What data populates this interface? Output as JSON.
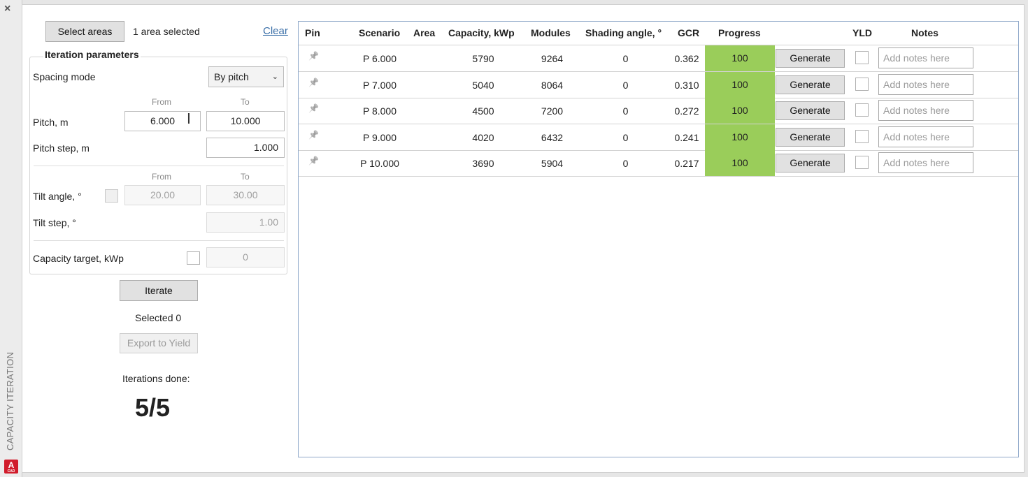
{
  "window": {
    "side_title": "CAPACITY ITERATION",
    "close_glyph": "×",
    "logo_text": "A",
    "logo_sub": "CAD"
  },
  "left": {
    "select_areas_label": "Select areas",
    "selection_status": "1 area selected",
    "clear_label": "Clear",
    "group_title": "Iteration parameters",
    "spacing_mode_label": "Spacing mode",
    "spacing_mode_value": "By pitch",
    "pitch": {
      "from_hint": "From",
      "to_hint": "To",
      "label": "Pitch, m",
      "from": "6.000",
      "to": "10.000"
    },
    "pitch_step": {
      "label": "Pitch step, m",
      "value": "1.000"
    },
    "tilt": {
      "from_hint": "From",
      "to_hint": "To",
      "label": "Tilt angle, °",
      "from": "20.00",
      "to": "30.00"
    },
    "tilt_step": {
      "label": "Tilt step, °",
      "value": "1.00"
    },
    "capacity_target": {
      "label": "Capacity target, kWp",
      "value": "0"
    },
    "iterate_label": "Iterate",
    "selected_text": "Selected 0",
    "export_label": "Export to Yield",
    "iterations_done_label": "Iterations done:",
    "iterations_done_value": "5/5"
  },
  "table": {
    "headers": {
      "pin": "Pin",
      "scenario": "Scenario",
      "area": "Area",
      "capacity": "Capacity, kWp",
      "modules": "Modules",
      "shading": "Shading angle, °",
      "gcr": "GCR",
      "progress": "Progress",
      "yld": "YLD",
      "notes": "Notes"
    },
    "generate_label": "Generate",
    "notes_placeholder": "Add notes here",
    "rows": [
      {
        "scenario": "P 6.000",
        "area": "",
        "capacity": "5790",
        "modules": "9264",
        "shading": "0",
        "gcr": "0.362",
        "progress": "100"
      },
      {
        "scenario": "P 7.000",
        "area": "",
        "capacity": "5040",
        "modules": "8064",
        "shading": "0",
        "gcr": "0.310",
        "progress": "100"
      },
      {
        "scenario": "P 8.000",
        "area": "",
        "capacity": "4500",
        "modules": "7200",
        "shading": "0",
        "gcr": "0.272",
        "progress": "100"
      },
      {
        "scenario": "P 9.000",
        "area": "",
        "capacity": "4020",
        "modules": "6432",
        "shading": "0",
        "gcr": "0.241",
        "progress": "100"
      },
      {
        "scenario": "P 10.000",
        "area": "",
        "capacity": "3690",
        "modules": "5904",
        "shading": "0",
        "gcr": "0.217",
        "progress": "100"
      }
    ]
  },
  "colors": {
    "progress_fill": "#9acd5a",
    "link": "#3a6fa8",
    "table_border": "#8fa8c9"
  }
}
